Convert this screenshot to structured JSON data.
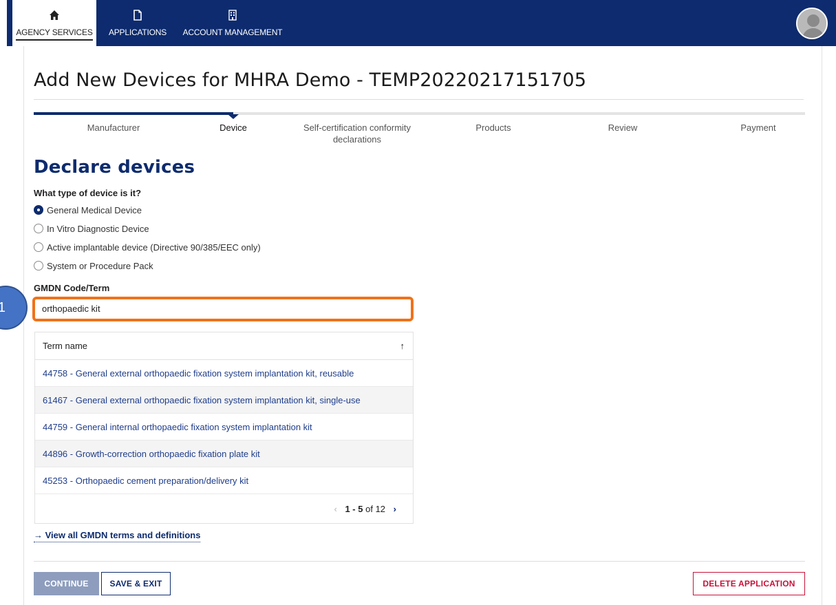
{
  "nav": {
    "items": [
      {
        "label": "AGENCY SERVICES",
        "icon": "home-icon"
      },
      {
        "label": "APPLICATIONS",
        "icon": "document-icon"
      },
      {
        "label": "ACCOUNT MANAGEMENT",
        "icon": "building-icon"
      }
    ],
    "avatar_icon": "user-avatar-icon"
  },
  "page": {
    "title": "Add New Devices for MHRA Demo - TEMP20220217151705"
  },
  "stepper": {
    "steps": [
      {
        "label": "Manufacturer"
      },
      {
        "label": "Device"
      },
      {
        "label": "Self-certification conformity declarations"
      },
      {
        "label": "Products"
      },
      {
        "label": "Review"
      },
      {
        "label": "Payment"
      }
    ],
    "active": "Device"
  },
  "form": {
    "heading": "Declare devices",
    "device_type_question": "What type of device is it?",
    "device_types": [
      {
        "label": "General Medical Device",
        "selected": true
      },
      {
        "label": "In Vitro Diagnostic Device",
        "selected": false
      },
      {
        "label": "Active implantable device (Directive 90/385/EEC only)",
        "selected": false
      },
      {
        "label": "System or Procedure Pack",
        "selected": false
      }
    ],
    "gmdn_label": "GMDN Code/Term",
    "gmdn_value": "orthopaedic kit"
  },
  "results": {
    "column_header": "Term name",
    "sort_icon": "sort-up-arrow-icon",
    "rows": [
      "44758 - General external orthopaedic fixation system implantation kit, reusable",
      "61467 - General external orthopaedic fixation system implantation kit, single-use",
      "44759 - General internal orthopaedic fixation system implantation kit",
      "44896 - Growth-correction orthopaedic fixation plate kit",
      "45253 - Orthopaedic cement preparation/delivery kit"
    ],
    "pager": {
      "range": "1 - 5",
      "of_text": "of 12"
    }
  },
  "links": {
    "view_all": "→ View all GMDN terms and definitions"
  },
  "buttons": {
    "continue": "CONTINUE",
    "save_exit": "SAVE & EXIT",
    "delete": "DELETE APPLICATION"
  },
  "annotation": {
    "number": "1"
  },
  "colors": {
    "nav_bg": "#0d2b6e",
    "heading": "#0d2b6e",
    "highlight": "#f07219",
    "delete": "#c8113a"
  }
}
